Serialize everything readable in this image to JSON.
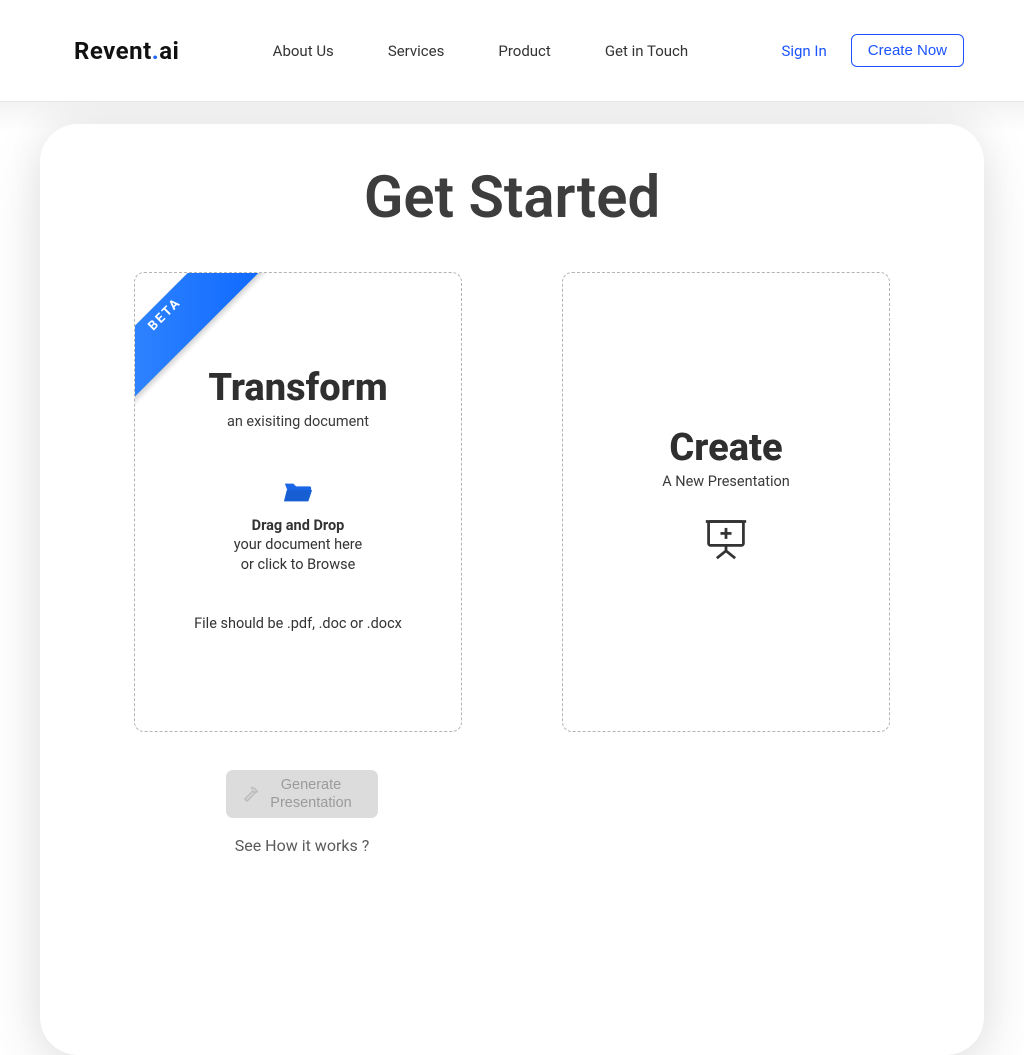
{
  "brand": {
    "name": "Revent",
    "dot": ".",
    "tld": "ai"
  },
  "nav": {
    "about": "About Us",
    "services": "Services",
    "product": "Product",
    "contact": "Get in Touch"
  },
  "auth": {
    "signin": "Sign In",
    "cta": "Create Now"
  },
  "page_title": "Get Started",
  "transform": {
    "ribbon": "BETA",
    "title": "Transform",
    "subtitle": "an exisiting document",
    "drop_bold": "Drag and Drop",
    "drop_l1": "your document here",
    "drop_l2": "or click to Browse",
    "hint": "File should be .pdf, .doc or .docx"
  },
  "create": {
    "title": "Create",
    "subtitle": "A New Presentation"
  },
  "actions": {
    "generate_l1": "Generate",
    "generate_l2": "Presentation",
    "howit": "See How it works ?"
  }
}
